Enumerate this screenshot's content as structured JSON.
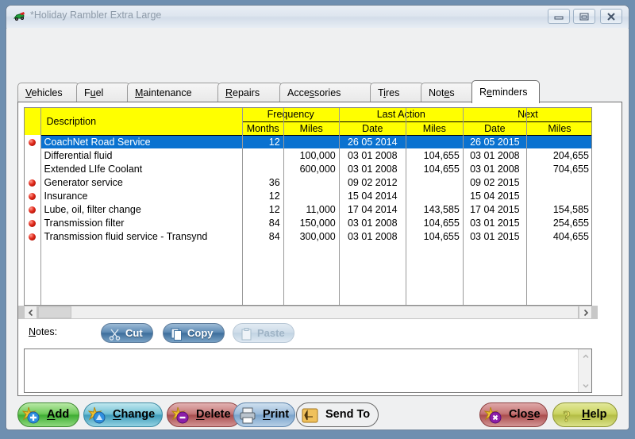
{
  "window": {
    "title": "*Holiday Rambler Extra Large",
    "icon": "vehicle-icon",
    "controls": {
      "minimize": "minimize-icon",
      "maximize": "maximize-icon",
      "close": "close-icon"
    }
  },
  "tabs": [
    {
      "label": "Vehicles",
      "accel_index": 0,
      "active": false
    },
    {
      "label": "Fuel",
      "accel_index": 1,
      "active": false
    },
    {
      "label": "Maintenance",
      "accel_index": 0,
      "active": false
    },
    {
      "label": "Repairs",
      "accel_index": 0,
      "active": false
    },
    {
      "label": "Accessories",
      "accel_index": 4,
      "active": false
    },
    {
      "label": "Tires",
      "accel_index": 1,
      "active": false
    },
    {
      "label": "Notes",
      "accel_index": 3,
      "active": false
    },
    {
      "label": "Reminders",
      "accel_index": 1,
      "active": true
    }
  ],
  "grid": {
    "group_headers": {
      "description": "Description",
      "frequency": "Frequency",
      "last_action": "Last Action",
      "next": "Next"
    },
    "sub_headers": {
      "months": "Months",
      "freq_miles": "Miles",
      "last_date": "Date",
      "last_miles": "Miles",
      "next_date": "Date",
      "next_miles": "Miles"
    },
    "marker_color": "#e02718",
    "selection_color": "#0a72d0",
    "header_color": "#ffff00",
    "rows": [
      {
        "marker": true,
        "selected": true,
        "description": "CoachNet Road Service",
        "months": "12",
        "freq_miles": "",
        "last_date": "26 05 2014",
        "last_miles": "",
        "next_date": "26 05 2015",
        "next_miles": ""
      },
      {
        "marker": false,
        "selected": false,
        "description": "Differential fluid",
        "months": "",
        "freq_miles": "100,000",
        "last_date": "03 01 2008",
        "last_miles": "104,655",
        "next_date": "03 01 2008",
        "next_miles": "204,655"
      },
      {
        "marker": false,
        "selected": false,
        "description": "Extended LIfe Coolant",
        "months": "",
        "freq_miles": "600,000",
        "last_date": "03 01 2008",
        "last_miles": "104,655",
        "next_date": "03 01 2008",
        "next_miles": "704,655"
      },
      {
        "marker": true,
        "selected": false,
        "description": "Generator service",
        "months": "36",
        "freq_miles": "",
        "last_date": "09 02 2012",
        "last_miles": "",
        "next_date": "09 02 2015",
        "next_miles": ""
      },
      {
        "marker": true,
        "selected": false,
        "description": "Insurance",
        "months": "12",
        "freq_miles": "",
        "last_date": "15 04 2014",
        "last_miles": "",
        "next_date": "15 04 2015",
        "next_miles": ""
      },
      {
        "marker": true,
        "selected": false,
        "description": "Lube, oil, filter change",
        "months": "12",
        "freq_miles": "11,000",
        "last_date": "17 04 2014",
        "last_miles": "143,585",
        "next_date": "17 04 2015",
        "next_miles": "154,585"
      },
      {
        "marker": true,
        "selected": false,
        "description": "Transmission filter",
        "months": "84",
        "freq_miles": "150,000",
        "last_date": "03 01 2008",
        "last_miles": "104,655",
        "next_date": "03 01 2015",
        "next_miles": "254,655"
      },
      {
        "marker": true,
        "selected": false,
        "description": "Transmission fluid service - Transynd",
        "months": "84",
        "freq_miles": "300,000",
        "last_date": "03 01 2008",
        "last_miles": "104,655",
        "next_date": "03 01 2015",
        "next_miles": "404,655"
      }
    ]
  },
  "scrollbars": {
    "h_left": "scroll-left-icon",
    "h_right": "scroll-right-icon",
    "v_up": "scroll-up-icon",
    "v_down": "scroll-down-icon"
  },
  "notes": {
    "label": "Notes:",
    "value": "",
    "placeholder": "",
    "cut": {
      "label": "Cut",
      "icon": "scissors-icon",
      "enabled": true
    },
    "copy": {
      "label": "Copy",
      "icon": "copy-pages-icon",
      "enabled": true
    },
    "paste": {
      "label": "Paste",
      "icon": "clipboard-icon",
      "enabled": false
    }
  },
  "toolbar": [
    {
      "key": "add",
      "label": "Add",
      "accel_index": 0,
      "icon": "star-plus-icon"
    },
    {
      "key": "change",
      "label": "Change",
      "accel_index": 0,
      "icon": "star-edit-icon"
    },
    {
      "key": "delete",
      "label": "Delete",
      "accel_index": 0,
      "icon": "star-delete-icon"
    },
    {
      "key": "print",
      "label": "Print",
      "accel_index": 0,
      "icon": "printer-icon"
    },
    {
      "key": "sendto",
      "label": "Send To",
      "accel_index": -1,
      "icon": "send-arrow-icon"
    },
    {
      "key": "close",
      "label": "Close",
      "accel_index": 3,
      "icon": "star-close-icon"
    },
    {
      "key": "help",
      "label": "Help",
      "accel_index": 0,
      "icon": "question-mark-icon"
    }
  ]
}
